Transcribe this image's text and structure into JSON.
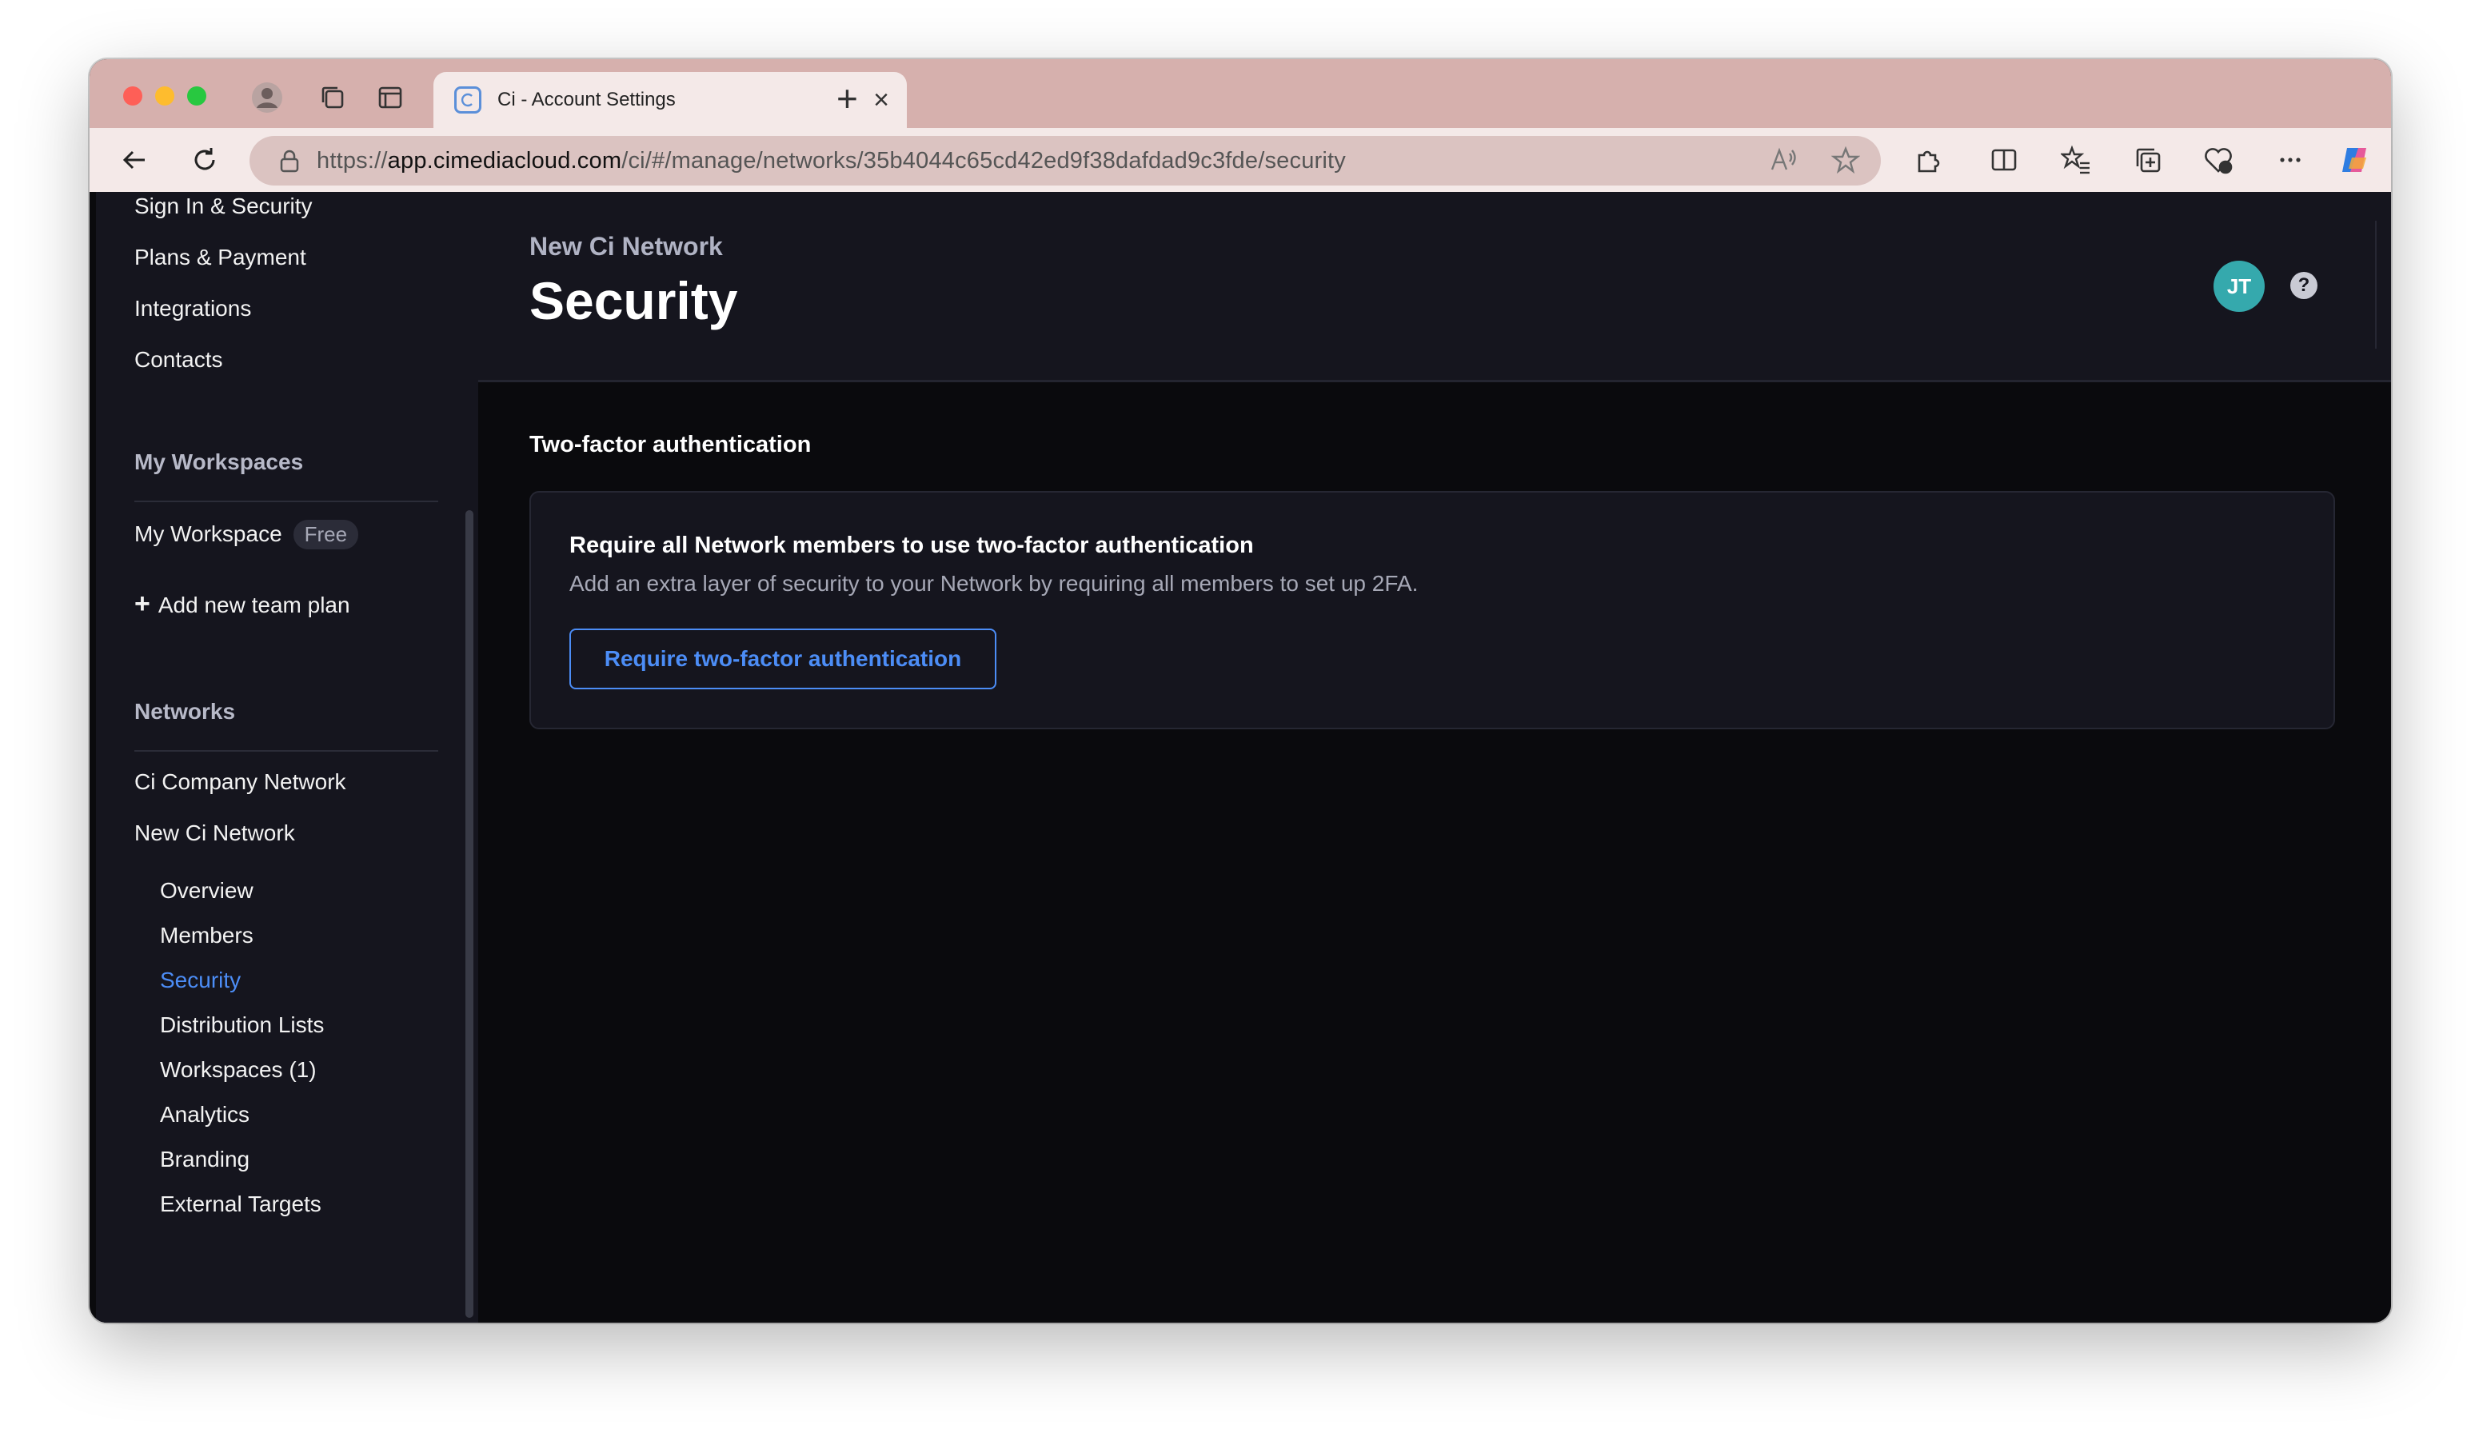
{
  "browser": {
    "tab_title": "Ci - Account Settings",
    "url_prefix": "https://",
    "url_host": "app.cimediacloud.com",
    "url_path": "/ci/#/manage/networks/35b4044c65cd42ed9f38dafdad9c3fde/security"
  },
  "sidebar": {
    "account_items": [
      "Sign In & Security",
      "Plans & Payment",
      "Integrations",
      "Contacts"
    ],
    "workspaces_heading": "My Workspaces",
    "workspace_name": "My Workspace",
    "workspace_badge": "Free",
    "add_team_plan": "Add new team plan",
    "networks_heading": "Networks",
    "networks": [
      "Ci Company Network",
      "New Ci Network"
    ],
    "network_subitems": [
      "Overview",
      "Members",
      "Security",
      "Distribution Lists",
      "Workspaces (1)",
      "Analytics",
      "Branding",
      "External Targets"
    ],
    "active_subitem": "Security"
  },
  "header": {
    "breadcrumb": "New Ci Network",
    "title": "Security",
    "avatar_initials": "JT",
    "help_glyph": "?"
  },
  "main": {
    "section_title": "Two-factor authentication",
    "card_title": "Require all Network members to use two-factor authentication",
    "card_description": "Add an extra layer of security to your Network by requiring all members to set up 2FA.",
    "card_button": "Require two-factor authentication"
  },
  "colors": {
    "accent": "#4c8df6",
    "avatar": "#35a9ad",
    "background": "#0a0a0d",
    "panel": "#15151e"
  }
}
